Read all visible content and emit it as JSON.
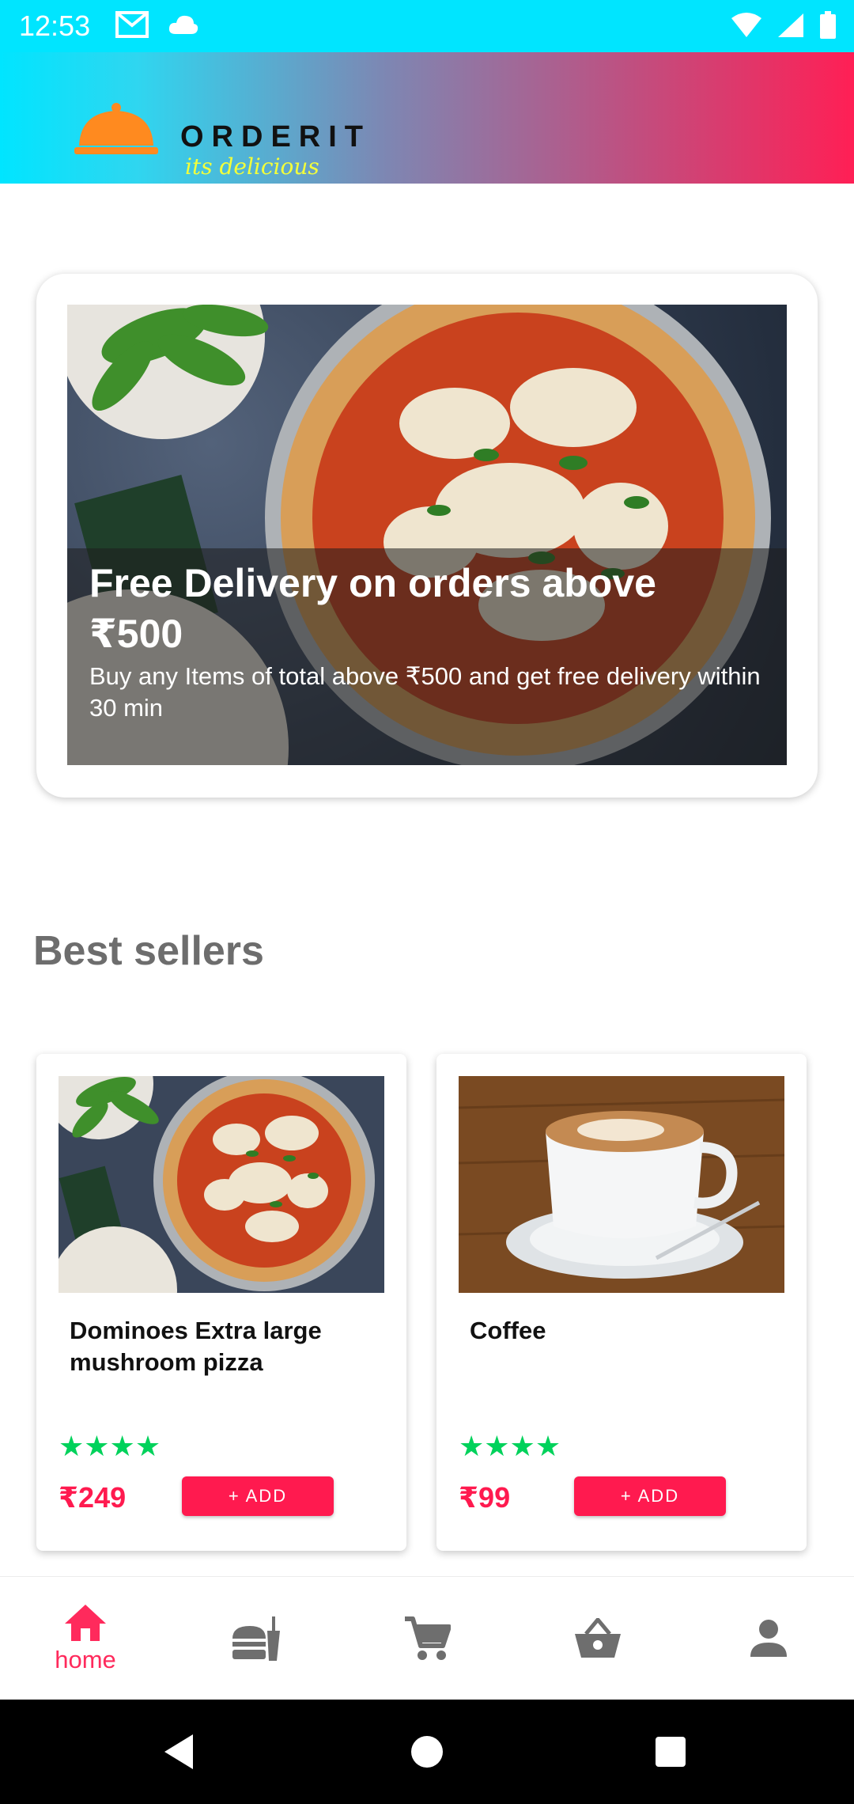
{
  "status_bar": {
    "time": "12:53",
    "icons": [
      "gmail-icon",
      "cloud-icon",
      "wifi-icon",
      "signal-icon",
      "battery-icon"
    ]
  },
  "app_bar": {
    "brand": "ORDERIT",
    "tagline": "its delicious",
    "logo_icon": "cloche-icon",
    "colors": {
      "gradient_start": "#00e5ff",
      "gradient_end": "#ff1f55",
      "logo_orange": "#ff8a1f",
      "tagline_yellow": "#f3ff3a"
    }
  },
  "promo": {
    "title": "Free Delivery on orders above ₹500",
    "subtitle": "Buy any Items of total above ₹500 and get free delivery within 30 min"
  },
  "best_sellers": {
    "heading": "Best sellers",
    "products": [
      {
        "name": "Dominoes Extra large mushroom pizza",
        "rating": 4,
        "stars": "★★★★",
        "price": "₹249",
        "add_label": "+ ADD"
      },
      {
        "name": "Coffee",
        "rating": 4,
        "stars": "★★★★",
        "price": "₹99",
        "add_label": "+ ADD"
      }
    ]
  },
  "bottom_nav": {
    "items": [
      {
        "label": "home",
        "icon": "home-icon",
        "active": true
      },
      {
        "icon": "food-icon",
        "active": false
      },
      {
        "icon": "cart-icon",
        "active": false
      },
      {
        "icon": "basket-icon",
        "active": false
      },
      {
        "icon": "profile-icon",
        "active": false
      }
    ],
    "colors": {
      "active": "#ff2a5c",
      "inactive": "#6e6e6e"
    }
  },
  "accent": "#ff1a4f",
  "star_color": "#00d25b"
}
